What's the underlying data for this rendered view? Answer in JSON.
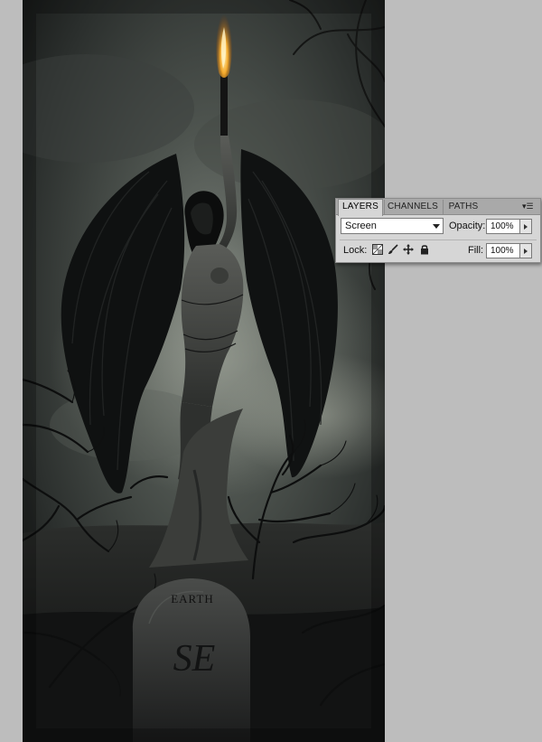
{
  "panel": {
    "tabs": [
      {
        "label": "LAYERS",
        "active": true
      },
      {
        "label": "CHANNELS",
        "active": false
      },
      {
        "label": "PATHS",
        "active": false
      }
    ],
    "menu_icon": "panel-menu-icon",
    "blend_mode": "Screen",
    "opacity_label": "Opacity:",
    "opacity_value": "100%",
    "lock_label": "Lock:",
    "lock_icons": [
      "lock-transparent-icon",
      "lock-pixels-icon",
      "lock-position-icon",
      "lock-all-icon"
    ],
    "fill_label": "Fill:",
    "fill_value": "100%"
  },
  "artwork": {
    "tombstone_text": "EARTH",
    "tombstone_monogram": "SE"
  },
  "colors": {
    "workspace": "#bdbdbd",
    "panel": "#d6d6d6",
    "torch_flame": "#e8a030"
  }
}
